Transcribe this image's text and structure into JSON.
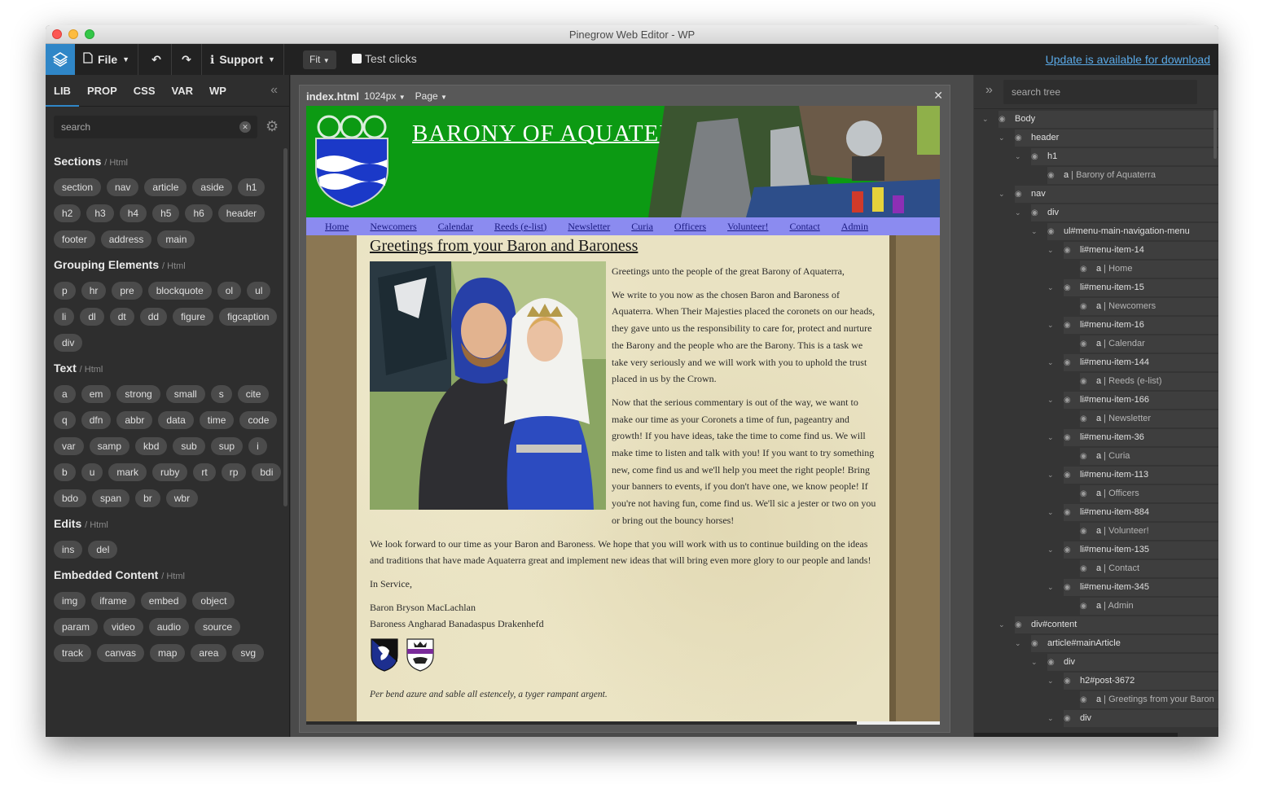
{
  "window": {
    "title": "Pinegrow Web Editor - WP"
  },
  "toolbar": {
    "file_label": "File",
    "support_label": "Support",
    "fit_label": "Fit",
    "test_clicks_label": "Test clicks",
    "update_link": "Update is available for download"
  },
  "left_panel": {
    "tabs": [
      "LIB",
      "PROP",
      "CSS",
      "VAR",
      "WP"
    ],
    "search_placeholder": "search",
    "sections": [
      {
        "title": "Sections",
        "sub": "/ Html",
        "items": [
          "section",
          "nav",
          "article",
          "aside",
          "h1",
          "h2",
          "h3",
          "h4",
          "h5",
          "h6",
          "header",
          "footer",
          "address",
          "main"
        ]
      },
      {
        "title": "Grouping Elements",
        "sub": "/ Html",
        "items": [
          "p",
          "hr",
          "pre",
          "blockquote",
          "ol",
          "ul",
          "li",
          "dl",
          "dt",
          "dd",
          "figure",
          "figcaption",
          "div"
        ]
      },
      {
        "title": "Text",
        "sub": "/ Html",
        "items": [
          "a",
          "em",
          "strong",
          "small",
          "s",
          "cite",
          "q",
          "dfn",
          "abbr",
          "data",
          "time",
          "code",
          "var",
          "samp",
          "kbd",
          "sub",
          "sup",
          "i",
          "b",
          "u",
          "mark",
          "ruby",
          "rt",
          "rp",
          "bdi",
          "bdo",
          "span",
          "br",
          "wbr"
        ]
      },
      {
        "title": "Edits",
        "sub": "/ Html",
        "items": [
          "ins",
          "del"
        ]
      },
      {
        "title": "Embedded Content",
        "sub": "/ Html",
        "items": [
          "img",
          "iframe",
          "embed",
          "object",
          "param",
          "video",
          "audio",
          "source",
          "track",
          "canvas",
          "map",
          "area",
          "svg"
        ]
      }
    ]
  },
  "canvas": {
    "file_name": "index.html",
    "width_label": "1024px",
    "page_label": "Page"
  },
  "site": {
    "banner_title": "BARONY OF AQUATERRA",
    "nav": [
      "Home",
      "Newcomers",
      "Calendar",
      "Reeds (e-list)",
      "Newsletter",
      "Curia",
      "Officers",
      "Volunteer!",
      "Contact",
      "Admin"
    ],
    "post_title": "Greetings from your Baron and Baroness",
    "paragraphs": [
      "Greetings unto the people of the great Barony of Aquaterra,",
      "We write to you now as the chosen Baron and Baroness of Aquaterra. When Their Majesties placed the coronets on our heads, they gave unto us the responsibility to care for, protect and nurture the Barony and the people who are the Barony. This is a task we take very seriously and we will work with you to uphold the trust placed in us by the Crown.",
      "Now that the serious commentary is out of the way, we want to make our time as your Coronets a time of fun, pageantry and growth! If you have ideas, take the time to come find us. We will make time to listen and talk with you! If you want to try something new, come find us and we'll help you meet the right people! Bring your banners to events, if you don't have one, we know people! If you're not having fun, come find us. We'll sic a jester or two on you or bring out the bouncy horses!",
      "We look forward to our time as your Baron and Baroness. We hope that you will work with us to continue building on the ideas and traditions that have made Aquaterra great and implement new ideas that will bring even more glory to our people and lands!",
      "In Service,"
    ],
    "signatures": [
      "Baron Bryson MacLachlan",
      "Baroness Angharad Banadaspus Drakenhefd"
    ],
    "motto": "Per bend azure and sable all estencely, a tyger rampant argent."
  },
  "right_panel": {
    "search_placeholder": "search tree",
    "tree": [
      {
        "depth": 0,
        "tag": "Body",
        "text": ""
      },
      {
        "depth": 1,
        "tag": "header",
        "text": ""
      },
      {
        "depth": 2,
        "tag": "h1",
        "text": ""
      },
      {
        "depth": 3,
        "tag": "a",
        "text": "Barony of Aquaterra",
        "leaf": true
      },
      {
        "depth": 1,
        "tag": "nav",
        "text": ""
      },
      {
        "depth": 2,
        "tag": "div",
        "text": ""
      },
      {
        "depth": 3,
        "tag": "ul#menu-main-navigation-menu",
        "text": ""
      },
      {
        "depth": 4,
        "tag": "li#menu-item-14",
        "text": ""
      },
      {
        "depth": 5,
        "tag": "a",
        "text": "Home",
        "leaf": true
      },
      {
        "depth": 4,
        "tag": "li#menu-item-15",
        "text": ""
      },
      {
        "depth": 5,
        "tag": "a",
        "text": "Newcomers",
        "leaf": true
      },
      {
        "depth": 4,
        "tag": "li#menu-item-16",
        "text": ""
      },
      {
        "depth": 5,
        "tag": "a",
        "text": "Calendar",
        "leaf": true
      },
      {
        "depth": 4,
        "tag": "li#menu-item-144",
        "text": ""
      },
      {
        "depth": 5,
        "tag": "a",
        "text": "Reeds (e-list)",
        "leaf": true
      },
      {
        "depth": 4,
        "tag": "li#menu-item-166",
        "text": ""
      },
      {
        "depth": 5,
        "tag": "a",
        "text": "Newsletter",
        "leaf": true
      },
      {
        "depth": 4,
        "tag": "li#menu-item-36",
        "text": ""
      },
      {
        "depth": 5,
        "tag": "a",
        "text": "Curia",
        "leaf": true
      },
      {
        "depth": 4,
        "tag": "li#menu-item-113",
        "text": ""
      },
      {
        "depth": 5,
        "tag": "a",
        "text": "Officers",
        "leaf": true
      },
      {
        "depth": 4,
        "tag": "li#menu-item-884",
        "text": ""
      },
      {
        "depth": 5,
        "tag": "a",
        "text": "Volunteer!",
        "leaf": true
      },
      {
        "depth": 4,
        "tag": "li#menu-item-135",
        "text": ""
      },
      {
        "depth": 5,
        "tag": "a",
        "text": "Contact",
        "leaf": true
      },
      {
        "depth": 4,
        "tag": "li#menu-item-345",
        "text": ""
      },
      {
        "depth": 5,
        "tag": "a",
        "text": "Admin",
        "leaf": true
      },
      {
        "depth": 1,
        "tag": "div#content",
        "text": ""
      },
      {
        "depth": 2,
        "tag": "article#mainArticle",
        "text": ""
      },
      {
        "depth": 3,
        "tag": "div",
        "text": ""
      },
      {
        "depth": 4,
        "tag": "h2#post-3672",
        "text": ""
      },
      {
        "depth": 5,
        "tag": "a",
        "text": "Greetings from your Baron",
        "leaf": true
      },
      {
        "depth": 4,
        "tag": "div",
        "text": ""
      }
    ]
  },
  "colors": {
    "accent": "#2f86c7",
    "site_banner": "#0c9a13",
    "site_nav": "#8b8bf0",
    "update_link": "#5aa9e6"
  },
  "icons": [
    "pinegrow-logo-icon",
    "file-icon",
    "undo-icon",
    "redo-icon",
    "info-icon",
    "gear-icon",
    "eye-icon",
    "chevron-down-icon",
    "double-chevron-left-icon",
    "double-chevron-right-icon",
    "close-icon"
  ]
}
